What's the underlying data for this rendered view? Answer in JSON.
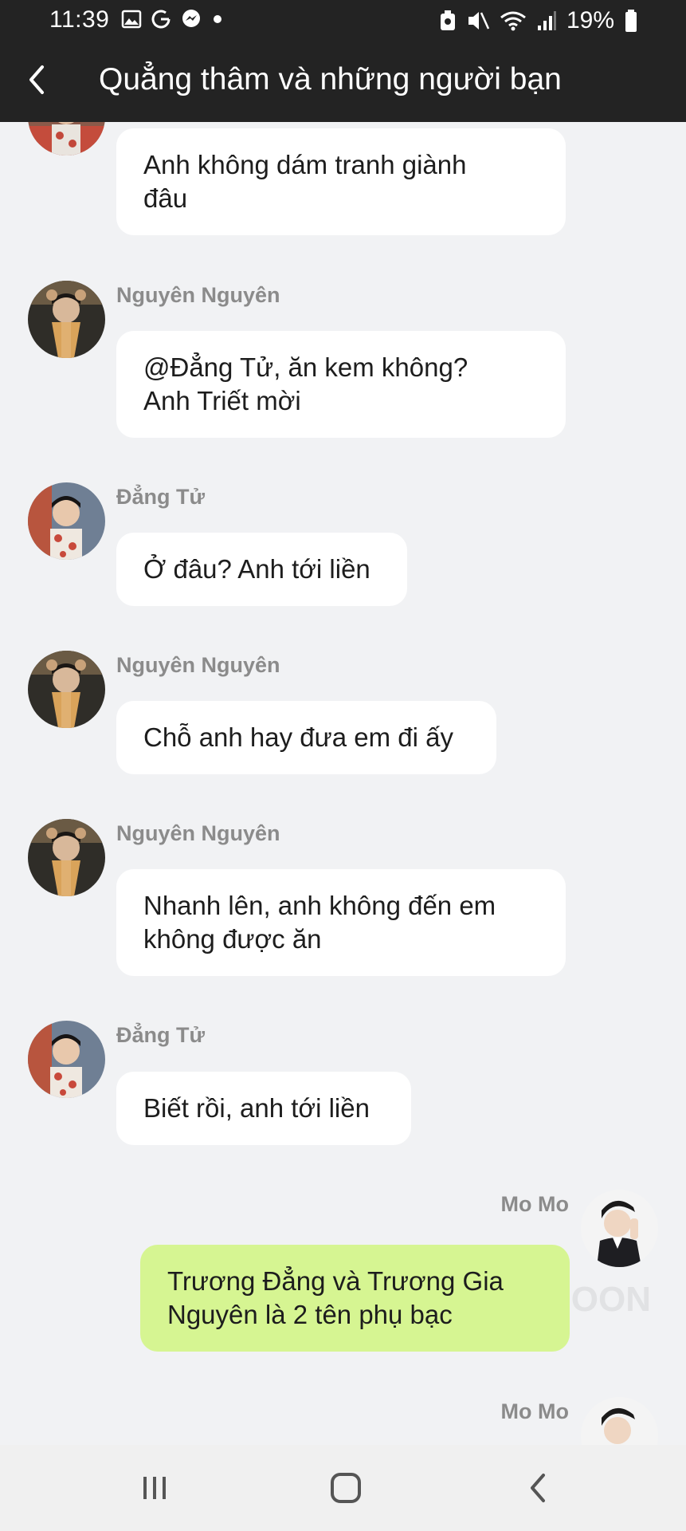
{
  "status_bar": {
    "time": "11:39",
    "battery_percent": "19%",
    "left_icons": [
      "image-icon",
      "g-icon",
      "messenger-icon",
      "dot-icon"
    ],
    "right_icons": [
      "recycle-icon",
      "mute-icon",
      "wifi-icon",
      "signal-icon",
      "battery-icon"
    ]
  },
  "header": {
    "title": "Quẳng thâm và những người bạn"
  },
  "messages": [
    {
      "sender": "",
      "text_line1": "Anh không dám tranh giành",
      "text_line2": "đâu"
    },
    {
      "sender": "Nguyên Nguyên",
      "text_line1": "@Đẳng Tử, ăn kem không?",
      "text_line2": "Anh Triết mời"
    },
    {
      "sender": "Đẳng Tử",
      "text_line1": "Ở đâu? Anh tới liền",
      "text_line2": ""
    },
    {
      "sender": "Nguyên Nguyên",
      "text_line1": "Chỗ anh hay đưa em đi ấy",
      "text_line2": ""
    },
    {
      "sender": "Nguyên Nguyên",
      "text_line1": "Nhanh lên, anh không đến em",
      "text_line2": "không được ăn"
    },
    {
      "sender": "Đẳng Tử",
      "text_line1": "Biết rồi, anh tới liền",
      "text_line2": ""
    },
    {
      "sender": "Mo Mo",
      "text_line1": "Trương Đẳng và Trương Gia",
      "text_line2": "Nguyên là 2 tên phụ bạc"
    },
    {
      "sender": "Mo Mo",
      "text_line1": "",
      "text_line2": ""
    }
  ],
  "watermark": "OON",
  "colors": {
    "header_bg": "#232323",
    "chat_bg": "#f1f2f4",
    "mine_bubble": "#d6f592",
    "other_bubble": "#ffffff"
  }
}
